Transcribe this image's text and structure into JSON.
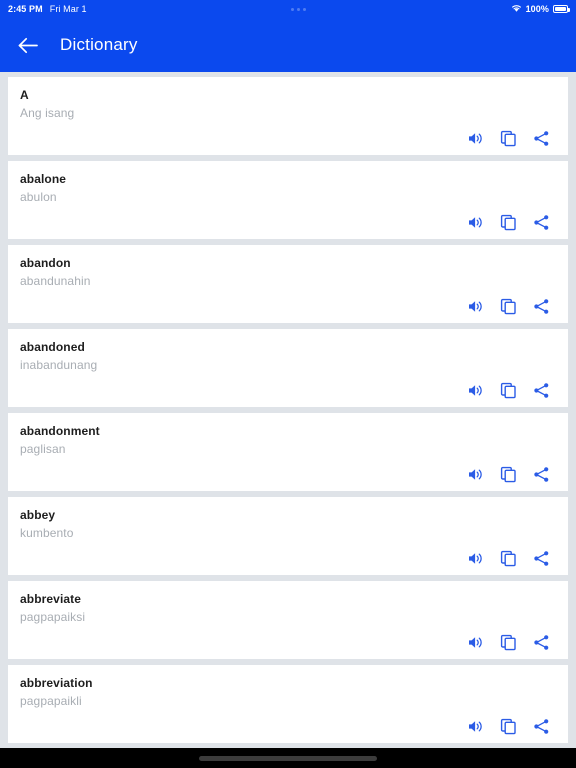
{
  "status_bar": {
    "time": "2:45 PM",
    "date": "Fri Mar 1",
    "battery_percent": "100%",
    "wifi_icon": "wifi-icon",
    "battery_icon": "battery-full-icon",
    "center_dots": "camera-dots-indicator"
  },
  "app_bar": {
    "back_icon": "arrow-left-icon",
    "title": "Dictionary",
    "background_color": "#0b49ee",
    "text_color": "#ffffff"
  },
  "theme": {
    "page_background": "#dfe3e8",
    "card_background": "#ffffff",
    "accent": "#0b49ee",
    "action_icon_color": "#2b5ce6",
    "word_color": "#1e1e1e",
    "translation_color": "#a8adb3"
  },
  "actions": {
    "speak_label": "speak",
    "copy_label": "copy",
    "share_label": "share",
    "speak_icon": "volume-up-icon",
    "copy_icon": "copy-icon",
    "share_icon": "share-icon"
  },
  "entries": [
    {
      "word": "A",
      "translation": "Ang isang"
    },
    {
      "word": "abalone",
      "translation": "abulon"
    },
    {
      "word": "abandon",
      "translation": "abandunahin"
    },
    {
      "word": "abandoned",
      "translation": "inabandunang"
    },
    {
      "word": "abandonment",
      "translation": "paglisan"
    },
    {
      "word": "abbey",
      "translation": "kumbento"
    },
    {
      "word": "abbreviate",
      "translation": "pagpapaiksi"
    },
    {
      "word": "abbreviation",
      "translation": "pagpapaikli"
    }
  ],
  "gesture_bar": {
    "home_indicator": "home-indicator-pill"
  }
}
